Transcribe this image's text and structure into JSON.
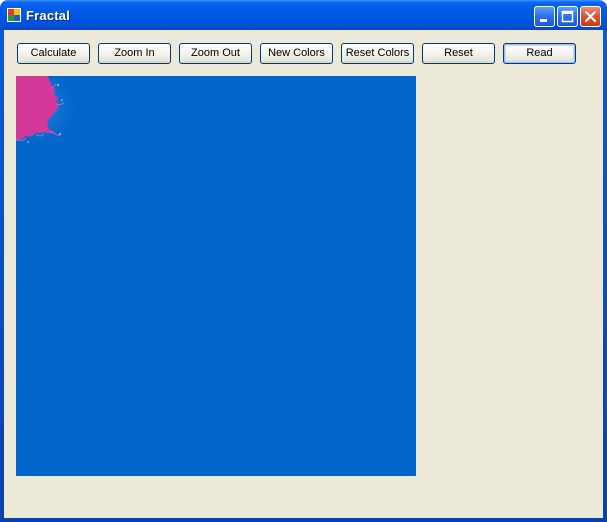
{
  "window": {
    "title": "Fractal",
    "controls": {
      "minimize_icon": "minimize-icon",
      "maximize_icon": "maximize-icon",
      "close_icon": "close-icon"
    }
  },
  "toolbar": {
    "buttons": [
      {
        "label": "Calculate"
      },
      {
        "label": "Zoom In"
      },
      {
        "label": "Zoom Out"
      },
      {
        "label": "New Colors"
      },
      {
        "label": "Reset Colors"
      },
      {
        "label": "Reset"
      },
      {
        "label": "Read"
      }
    ]
  },
  "canvas": {
    "background_color": "#0066cc",
    "fractal_color": "#d4399a"
  },
  "colors": {
    "titlebar": "#0055de",
    "client_background": "#ece9d8",
    "close_button": "#d8522d"
  }
}
